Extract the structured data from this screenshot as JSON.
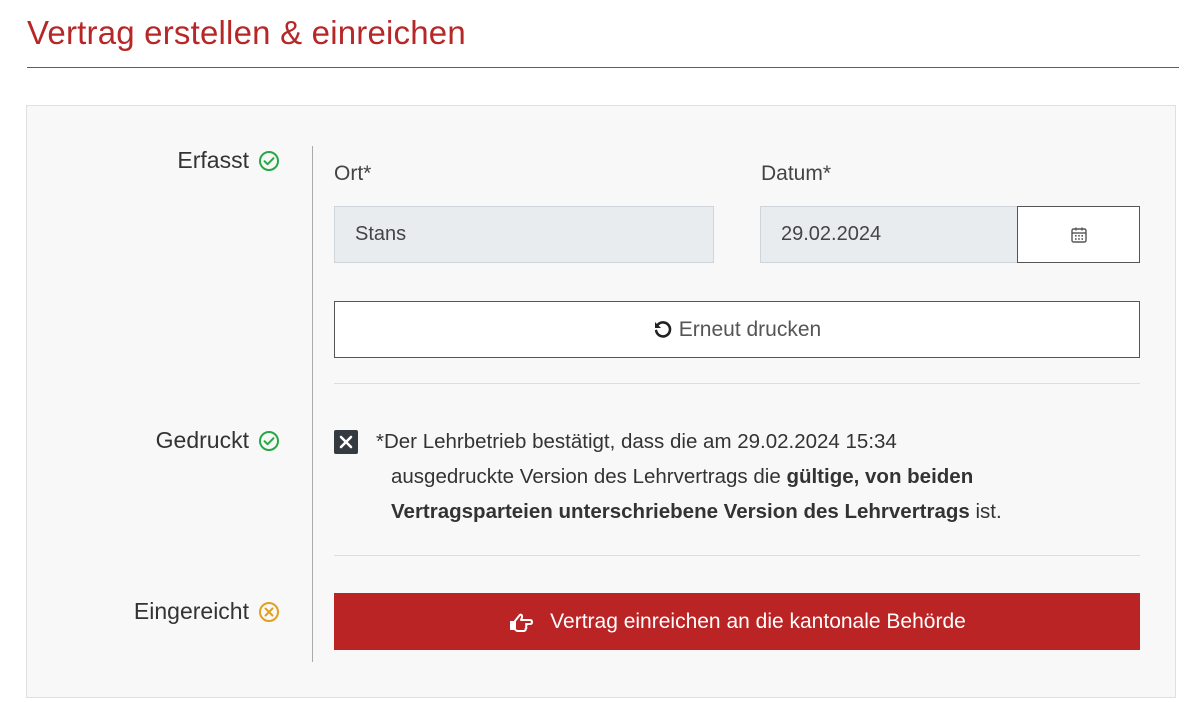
{
  "page": {
    "title": "Vertrag erstellen & einreichen"
  },
  "steps": {
    "erfasst": {
      "label": "Erfasst",
      "status": "done"
    },
    "gedruckt": {
      "label": "Gedruckt",
      "status": "done"
    },
    "eingereicht": {
      "label": "Eingereicht",
      "status": "pending"
    }
  },
  "form": {
    "ort_label": "Ort*",
    "ort_value": "Stans",
    "datum_label": "Datum*",
    "datum_value": "29.02.2024"
  },
  "reprint": {
    "label": "Erneut drucken",
    "icon": "redo-icon"
  },
  "confirm": {
    "checked": true,
    "line1": "*Der Lehrbetrieb bestätigt, dass die am 29.02.2024 15:34",
    "line2_pre": "ausgedruckte Version des Lehrvertrags die ",
    "line2_bold": "gültige, von beiden",
    "line3_bold": "Vertragsparteien unterschriebene Version des Lehrvertrags",
    "line3_post": " ist."
  },
  "submit": {
    "label": "Vertrag einreichen an die kantonale Behörde",
    "icon": "hand-point-right-icon"
  },
  "colors": {
    "accent": "#bb2424",
    "success": "#28a745",
    "warning": "#e0a020"
  }
}
